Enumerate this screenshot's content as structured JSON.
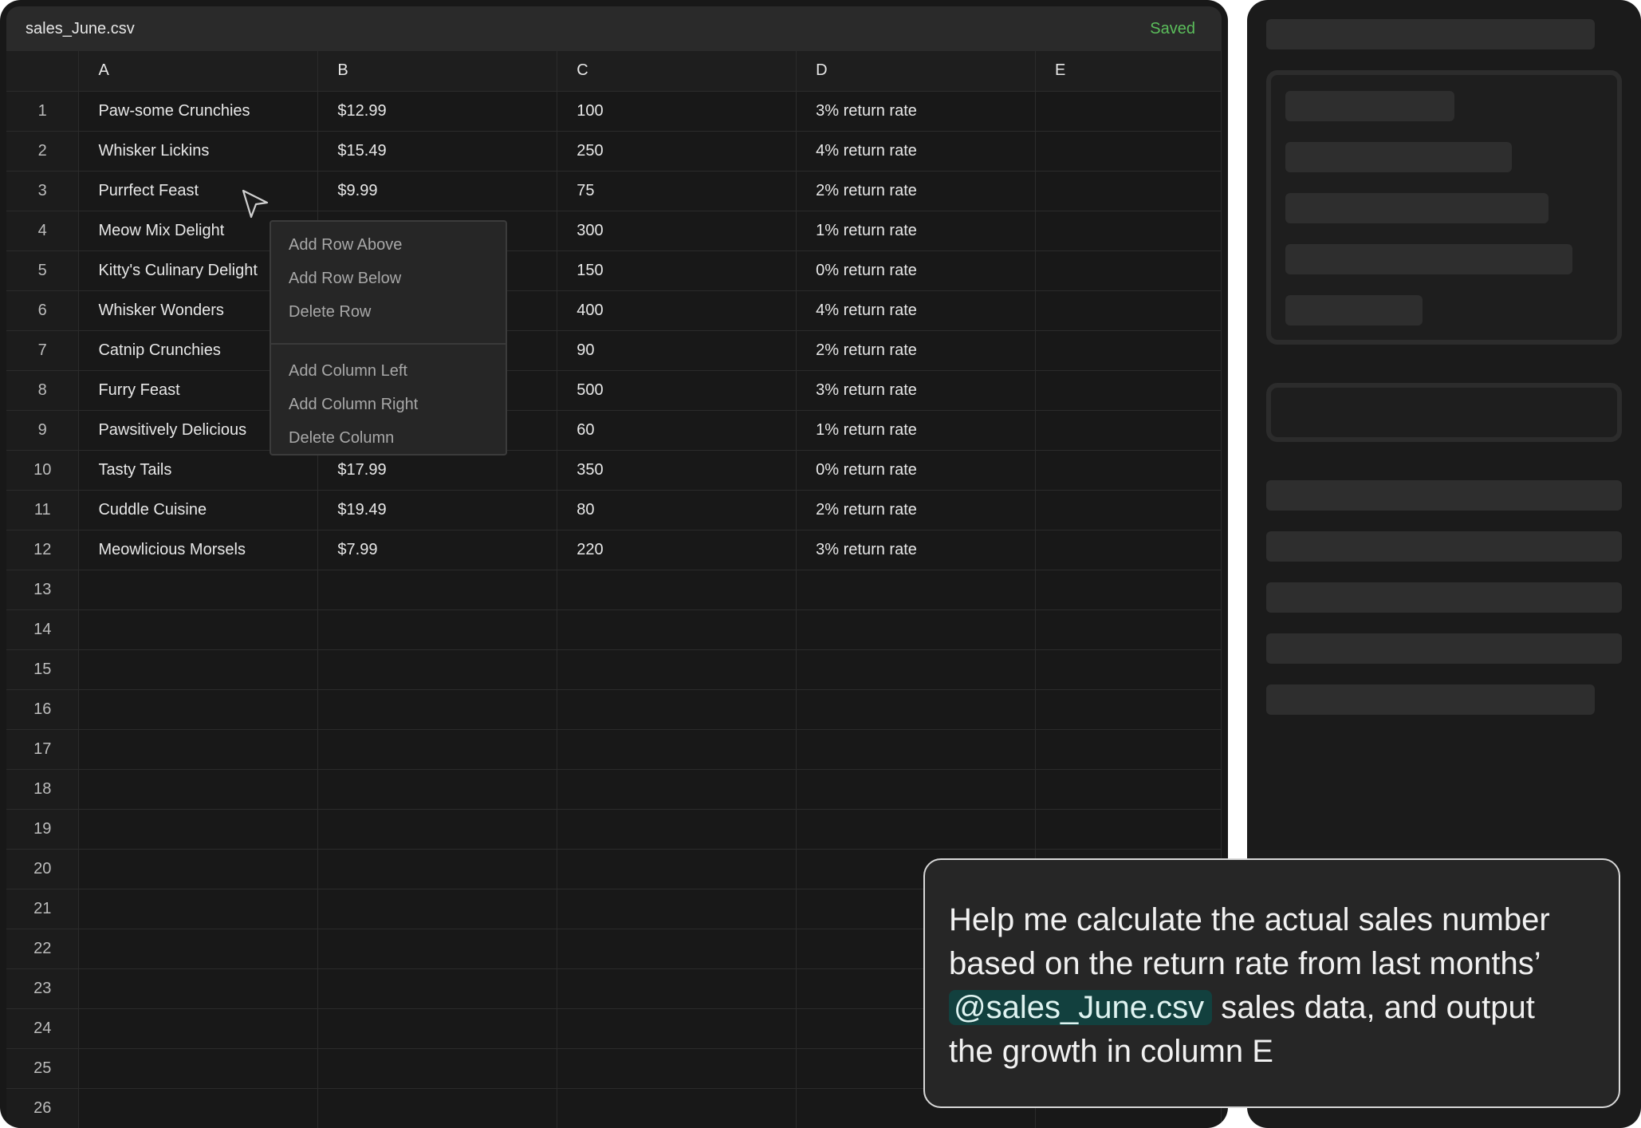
{
  "titlebar": {
    "file_name": "sales_June.csv",
    "status": "Saved",
    "status_color": "#5bbd5b"
  },
  "grid": {
    "columns": [
      "A",
      "B",
      "C",
      "D",
      "E"
    ],
    "rows": [
      {
        "num": "1",
        "cells": [
          "Paw-some Crunchies",
          "$12.99",
          "100",
          "3% return rate",
          ""
        ]
      },
      {
        "num": "2",
        "cells": [
          "Whisker Lickins",
          "$15.49",
          "250",
          "4% return rate",
          ""
        ]
      },
      {
        "num": "3",
        "cells": [
          "Purrfect Feast",
          "$9.99",
          "75",
          "2% return rate",
          ""
        ]
      },
      {
        "num": "4",
        "cells": [
          "Meow Mix Delight",
          "",
          "300",
          "1% return rate",
          ""
        ]
      },
      {
        "num": "5",
        "cells": [
          "Kitty's Culinary Delight",
          "",
          "150",
          "0% return rate",
          ""
        ]
      },
      {
        "num": "6",
        "cells": [
          "Whisker Wonders",
          "",
          "400",
          "4% return rate",
          ""
        ]
      },
      {
        "num": "7",
        "cells": [
          "Catnip Crunchies",
          "",
          "90",
          "2% return rate",
          ""
        ]
      },
      {
        "num": "8",
        "cells": [
          "Furry Feast",
          "",
          "500",
          "3% return rate",
          ""
        ]
      },
      {
        "num": "9",
        "cells": [
          "Pawsitively Delicious",
          "",
          "60",
          "1% return rate",
          ""
        ]
      },
      {
        "num": "10",
        "cells": [
          "Tasty Tails",
          "$17.99",
          "350",
          "0% return rate",
          ""
        ]
      },
      {
        "num": "11",
        "cells": [
          "Cuddle Cuisine",
          "$19.49",
          "80",
          "2% return rate",
          ""
        ]
      },
      {
        "num": "12",
        "cells": [
          "Meowlicious Morsels",
          "$7.99",
          "220",
          "3% return rate",
          ""
        ]
      },
      {
        "num": "13",
        "cells": [
          "",
          "",
          "",
          "",
          ""
        ]
      },
      {
        "num": "14",
        "cells": [
          "",
          "",
          "",
          "",
          ""
        ]
      },
      {
        "num": "15",
        "cells": [
          "",
          "",
          "",
          "",
          ""
        ]
      },
      {
        "num": "16",
        "cells": [
          "",
          "",
          "",
          "",
          ""
        ]
      },
      {
        "num": "17",
        "cells": [
          "",
          "",
          "",
          "",
          ""
        ]
      },
      {
        "num": "18",
        "cells": [
          "",
          "",
          "",
          "",
          ""
        ]
      },
      {
        "num": "19",
        "cells": [
          "",
          "",
          "",
          "",
          ""
        ]
      },
      {
        "num": "20",
        "cells": [
          "",
          "",
          "",
          "",
          ""
        ]
      },
      {
        "num": "21",
        "cells": [
          "",
          "",
          "",
          "",
          ""
        ]
      },
      {
        "num": "22",
        "cells": [
          "",
          "",
          "",
          "",
          ""
        ]
      },
      {
        "num": "23",
        "cells": [
          "",
          "",
          "",
          "",
          ""
        ]
      },
      {
        "num": "24",
        "cells": [
          "",
          "",
          "",
          "",
          ""
        ]
      },
      {
        "num": "25",
        "cells": [
          "",
          "",
          "",
          "",
          ""
        ]
      },
      {
        "num": "26",
        "cells": [
          "",
          "",
          "",
          "",
          ""
        ]
      }
    ]
  },
  "context_menu": {
    "row_items": [
      "Add Row Above",
      "Add Row Below",
      "Delete Row"
    ],
    "column_items": [
      "Add Column Left",
      "Add Column Right",
      "Delete Column"
    ]
  },
  "prompt": {
    "line1": "Help me calculate the actual sales number",
    "line2": "based on the return rate from last months’",
    "mention": "@sales_June.csv",
    "line3_rest": " sales data, and output",
    "line4": "the growth in column E"
  },
  "icons": {
    "cursor": "mouse-pointer-icon"
  }
}
